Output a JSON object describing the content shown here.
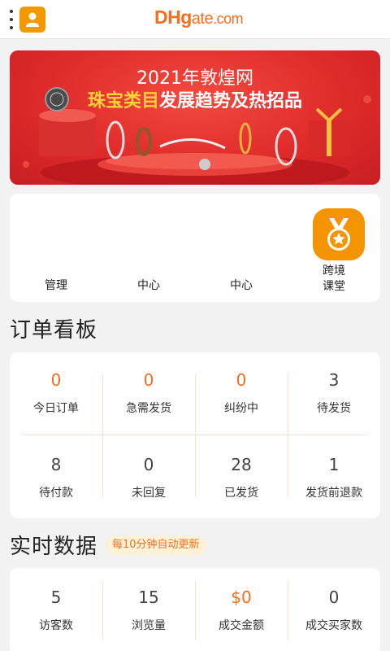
{
  "header": {
    "logo": {
      "dh": "DHg",
      "ate": "ate",
      "com": ".com"
    },
    "icons": {
      "menu": "vertical-dots-icon",
      "user": "user-icon"
    },
    "accent": "#f39800"
  },
  "banner": {
    "line1": "2021年敦煌网",
    "line2_highlight": "珠宝类目",
    "line2_rest": "发展趋势及热招品",
    "bg": "#e02b2b",
    "highlight_color": "#ffd23a"
  },
  "tools": [
    {
      "label": "管理",
      "icon": ""
    },
    {
      "label": "中心",
      "icon": ""
    },
    {
      "label": "中心",
      "icon": ""
    },
    {
      "label": "跨境\n课堂",
      "icon": "medal-icon"
    }
  ],
  "orders": {
    "title": "订单看板",
    "items": [
      {
        "value": "0",
        "label": "今日订单",
        "highlight": true
      },
      {
        "value": "0",
        "label": "急需发货",
        "highlight": true
      },
      {
        "value": "0",
        "label": "纠纷中",
        "highlight": true
      },
      {
        "value": "3",
        "label": "待发货",
        "highlight": false
      },
      {
        "value": "8",
        "label": "待付款",
        "highlight": false
      },
      {
        "value": "0",
        "label": "未回复",
        "highlight": false
      },
      {
        "value": "28",
        "label": "已发货",
        "highlight": false
      },
      {
        "value": "1",
        "label": "发货前退款",
        "highlight": false
      }
    ]
  },
  "realtime": {
    "title": "实时数据",
    "badge": "每10分钟自动更新",
    "items": [
      {
        "value": "5",
        "label": "访客数",
        "highlight": false
      },
      {
        "value": "15",
        "label": "浏览量",
        "highlight": false
      },
      {
        "value": "$0",
        "label": "成交金额",
        "highlight": true
      },
      {
        "value": "0",
        "label": "成交买家数",
        "highlight": false
      }
    ]
  }
}
